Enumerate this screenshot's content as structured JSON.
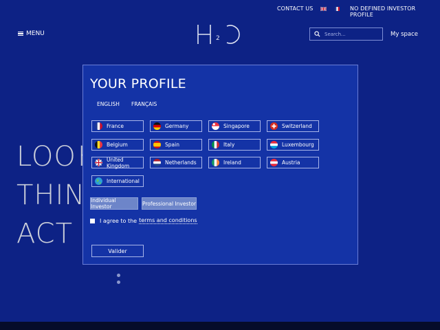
{
  "topbar": {
    "contact": "CONTACT US",
    "profile": "NO DEFINED INVESTOR PROFILE"
  },
  "header": {
    "menu_label": "MENU",
    "search_placeholder": "Search...",
    "myspace_label": "My space",
    "logo_subscript": "2"
  },
  "hero": {
    "line1": "LOOK",
    "line2": "THIN",
    "line3": "ACT"
  },
  "modal": {
    "title": "YOUR PROFILE",
    "languages": [
      "ENGLISH",
      "FRANÇAIS"
    ],
    "countries": [
      {
        "label": "France",
        "flag": "france-flag"
      },
      {
        "label": "Germany",
        "flag": "germany-flag"
      },
      {
        "label": "Singapore",
        "flag": "singapore-flag"
      },
      {
        "label": "Switzerland",
        "flag": "switzerland-flag"
      },
      {
        "label": "Belgium",
        "flag": "belgium-flag"
      },
      {
        "label": "Spain",
        "flag": "spain-flag"
      },
      {
        "label": "Italy",
        "flag": "italy-flag"
      },
      {
        "label": "Luxembourg",
        "flag": "luxembourg-flag"
      },
      {
        "label": "United Kingdom",
        "flag": "uk-flag"
      },
      {
        "label": "Netherlands",
        "flag": "netherlands-flag"
      },
      {
        "label": "Ireland",
        "flag": "ireland-flag"
      },
      {
        "label": "Austria",
        "flag": "austria-flag"
      },
      {
        "label": "International",
        "flag": "globe-icon"
      }
    ],
    "investor_types": [
      "Individual Investor",
      "Professional Investor"
    ],
    "agree_text": "I agree to the",
    "terms_link": "terms and conditions",
    "submit_label": "Valider"
  },
  "colors": {
    "background": "#0d2285",
    "modal": "#1433a6",
    "button": "#6d85c9"
  }
}
